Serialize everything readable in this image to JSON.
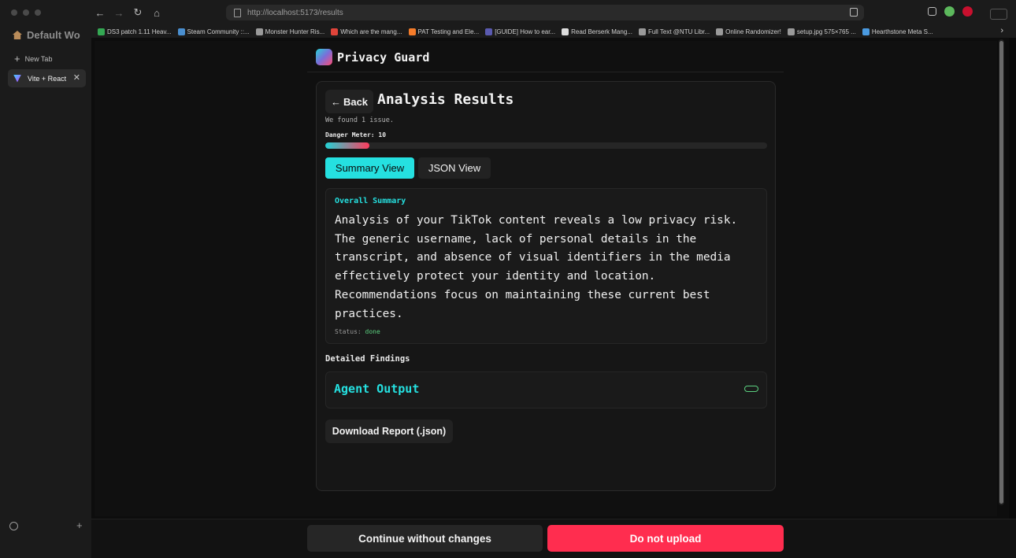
{
  "browser": {
    "url": "http://localhost:5173/results",
    "workspace_title": "Default Wo",
    "new_tab_label": "New Tab",
    "active_tab": {
      "label": "Vite + React",
      "icon": "vite-icon"
    },
    "bookmarks": [
      {
        "label": "DS3 patch 1.11 Heav...",
        "color": "#34a853"
      },
      {
        "label": "Steam Community ::...",
        "color": "#4a8fd0"
      },
      {
        "label": "Monster Hunter Ris...",
        "color": "#9a9a9a"
      },
      {
        "label": "Which are the mang...",
        "color": "#e0443a"
      },
      {
        "label": "PAT Testing and Ele...",
        "color": "#f57c2a"
      },
      {
        "label": "[GUIDE] How to ear...",
        "color": "#5a5ab0"
      },
      {
        "label": "Read Berserk Mang...",
        "color": "#dddddd"
      },
      {
        "label": "Full Text @NTU Libr...",
        "color": "#9a9a9a"
      },
      {
        "label": "Online Randomizer!",
        "color": "#9a9a9a"
      },
      {
        "label": "setup.jpg 575×765 ...",
        "color": "#9a9a9a"
      },
      {
        "label": "Hearthstone Meta S...",
        "color": "#4a9ae0"
      }
    ]
  },
  "app": {
    "title": "Privacy Guard"
  },
  "results": {
    "back_label": "Back",
    "title": "Analysis Results",
    "found_text": "We found 1 issue.",
    "danger_meter_label": "Danger Meter: 10",
    "danger_meter_value_percent": 10,
    "tabs": [
      {
        "label": "Summary View",
        "active": true
      },
      {
        "label": "JSON View",
        "active": false
      }
    ],
    "summary": {
      "heading": "Overall Summary",
      "text": "Analysis of your TikTok content reveals a low privacy risk. The generic username, lack of personal details in the transcript, and absence of visual identifiers in the media effectively protect your identity and location. Recommendations focus on maintaining these current best practices.",
      "status_label": "Status:",
      "status_value": "done"
    },
    "findings_label": "Detailed Findings",
    "agent_output_label": "Agent Output",
    "download_label": "Download Report (.json)"
  },
  "actions": {
    "continue_label": "Continue without changes",
    "do_not_upload_label": "Do not upload"
  },
  "colors": {
    "accent": "#25e0e0",
    "danger": "#ff2d4f",
    "status_ok": "#5bd07f"
  }
}
